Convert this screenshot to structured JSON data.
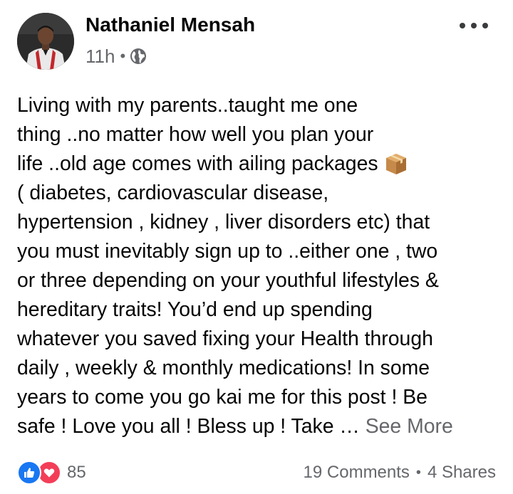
{
  "post": {
    "author": "Nathaniel Mensah",
    "time": "11h",
    "time_separator": "•",
    "privacy_icon": "globe-icon",
    "menu_icon": "more-horizontal-icon",
    "text_lines": [
      "Living with my parents..taught me one",
      "thing ..no matter how well you plan your",
      "life ..old age comes with ailing packages",
      "( diabetes, cardiovascular disease,",
      "hypertension , kidney , liver disorders etc) that",
      "you must inevitably sign up to ..either one , two",
      "or three depending on your youthful lifestyles &",
      "hereditary traits!  You’d end up spending",
      "whatever you saved fixing your Health through",
      "daily , weekly & monthly medications! In some",
      "years to come you go kai me for this post ! Be",
      "safe ! Love you all ! Bless up ! Take … "
    ],
    "inline_emoji": "package-emoji",
    "see_more": "See More"
  },
  "footer": {
    "reaction_icons": [
      "like-icon",
      "love-icon"
    ],
    "reaction_count": "85",
    "comments": "19 Comments",
    "separator": "•",
    "shares": "4 Shares"
  },
  "colors": {
    "text_primary": "#050505",
    "text_secondary": "#65676b",
    "like_blue": "#1877f2",
    "love_red": "#f33e58"
  }
}
